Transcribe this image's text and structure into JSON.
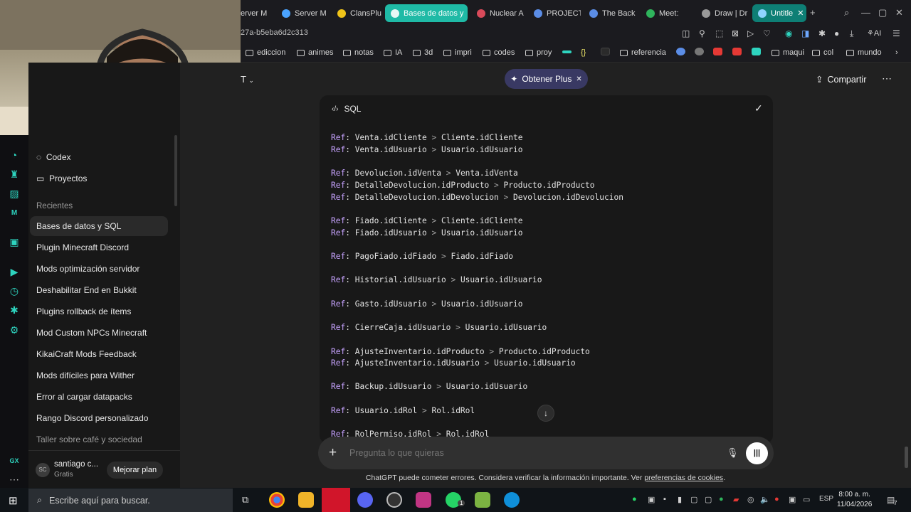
{
  "browser": {
    "tabs": [
      {
        "label": "erver M"
      },
      {
        "label": "Server M"
      },
      {
        "label": "ClansPlu"
      },
      {
        "label": "Bases de datos y"
      },
      {
        "label": "Nuclear A"
      },
      {
        "label": "PROJECT"
      },
      {
        "label": "The Back"
      },
      {
        "label": "Meet:"
      },
      {
        "label": "Draw | Dr"
      },
      {
        "label": "Untitle"
      }
    ],
    "url": "27a-b5eba6d2c313",
    "bookmarks": [
      "ediccion",
      "animes",
      "notas",
      "IA",
      "3d",
      "impri",
      "codes",
      "proy",
      "{}",
      "referencia",
      "maqui",
      "col",
      "mundo"
    ],
    "ai_label": "AI"
  },
  "sidebar": {
    "top_items": [
      {
        "label": "Codex"
      },
      {
        "label": "Proyectos"
      }
    ],
    "recent_heading": "Recientes",
    "recent": [
      "Bases de datos y SQL",
      "Plugin Minecraft Discord",
      "Mods optimización servidor",
      "Deshabilitar End en Bukkit",
      "Plugins rollback de ítems",
      "Mod Custom NPCs Minecraft",
      "KikaiCraft Mods Feedback",
      "Mods difíciles para Wither",
      "Error al cargar datapacks",
      "Rango Discord personalizado",
      "Taller sobre café y sociedad"
    ],
    "user": {
      "initials": "SC",
      "name": "santiago c...",
      "plan": "Gratis",
      "upgrade_label": "Mejorar plan"
    }
  },
  "header": {
    "model_stub": "T",
    "plus_label": "Obtener Plus",
    "share_label": "Compartir"
  },
  "code_block": {
    "language": "SQL",
    "lines": [
      {
        "left": "Venta.idCliente",
        "right": "Cliente.idCliente"
      },
      {
        "left": "Venta.idUsuario",
        "right": "Usuario.idUsuario"
      },
      {
        "left": "Devolucion.idVenta",
        "right": "Venta.idVenta"
      },
      {
        "left": "DetalleDevolucion.idProducto",
        "right": "Producto.idProducto"
      },
      {
        "left": "DetalleDevolucion.idDevolucion",
        "right": "Devolucion.idDevolucion"
      },
      {
        "left": "Fiado.idCliente",
        "right": "Cliente.idCliente"
      },
      {
        "left": "Fiado.idUsuario",
        "right": "Usuario.idUsuario"
      },
      {
        "left": "PagoFiado.idFiado",
        "right": "Fiado.idFiado"
      },
      {
        "left": "Historial.idUsuario",
        "right": "Usuario.idUsuario"
      },
      {
        "left": "Gasto.idUsuario",
        "right": "Usuario.idUsuario"
      },
      {
        "left": "CierreCaja.idUsuario",
        "right": "Usuario.idUsuario"
      },
      {
        "left": "AjusteInventario.idProducto",
        "right": "Producto.idProducto"
      },
      {
        "left": "AjusteInventario.idUsuario",
        "right": "Usuario.idUsuario"
      },
      {
        "left": "Backup.idUsuario",
        "right": "Usuario.idUsuario"
      },
      {
        "left": "Usuario.idRol",
        "right": "Rol.idRol"
      },
      {
        "left": "RolPermiso.idRol",
        "right": "Rol.idRol"
      }
    ],
    "keyword": "Ref",
    "operator": ">"
  },
  "composer": {
    "placeholder": "Pregunta lo que quieras"
  },
  "disclaimer": {
    "text": "ChatGPT puede cometer errores. Considera verificar la información importante. Ver ",
    "link": "preferencias de cookies",
    "end": "."
  },
  "taskbar": {
    "search_placeholder": "Escribe aquí para buscar.",
    "lang": "ESP",
    "time": "8:00 a. m.",
    "date": "11/04/2026",
    "notif_count": "7",
    "whatsapp_badge": "1"
  }
}
